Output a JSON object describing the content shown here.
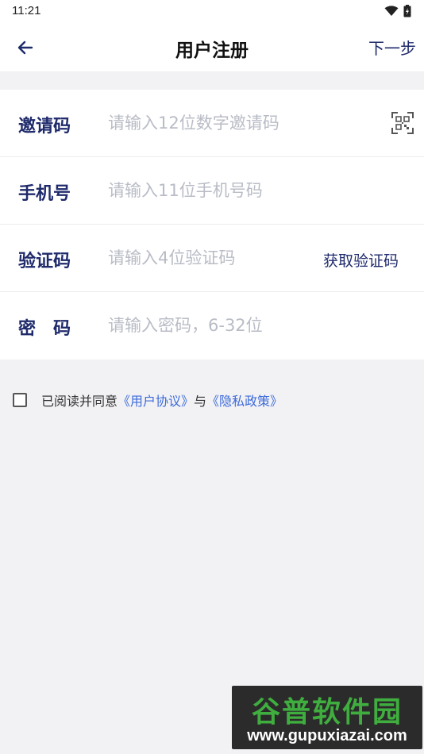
{
  "status_bar": {
    "time": "11:21"
  },
  "header": {
    "title": "用户注册",
    "next_label": "下一步"
  },
  "form": {
    "invite": {
      "label": "邀请码",
      "placeholder": "请输入12位数字邀请码",
      "value": ""
    },
    "phone": {
      "label": "手机号",
      "placeholder": "请输入11位手机号码",
      "value": ""
    },
    "code": {
      "label": "验证码",
      "placeholder": "请输入4位验证码",
      "value": "",
      "get_code_label": "获取验证码"
    },
    "password": {
      "label": "密　码",
      "placeholder": "请输入密码，6-32位",
      "value": ""
    }
  },
  "agreement": {
    "prefix": "已阅读并同意",
    "user_agreement": "《用户协议》",
    "connector": "与",
    "privacy_policy": "《隐私政策》",
    "checked": false
  },
  "watermark": {
    "line1": "谷普软件园",
    "line2": "www.gupuxiazai.com"
  },
  "colors": {
    "primary": "#1f2a6b",
    "link": "#3d6bd8",
    "placeholder": "#b9bcc6",
    "background": "#f2f2f5"
  },
  "icons": {
    "back": "arrow-left-icon",
    "scan": "qr-scan-icon",
    "wifi": "wifi-icon",
    "battery": "battery-icon"
  }
}
